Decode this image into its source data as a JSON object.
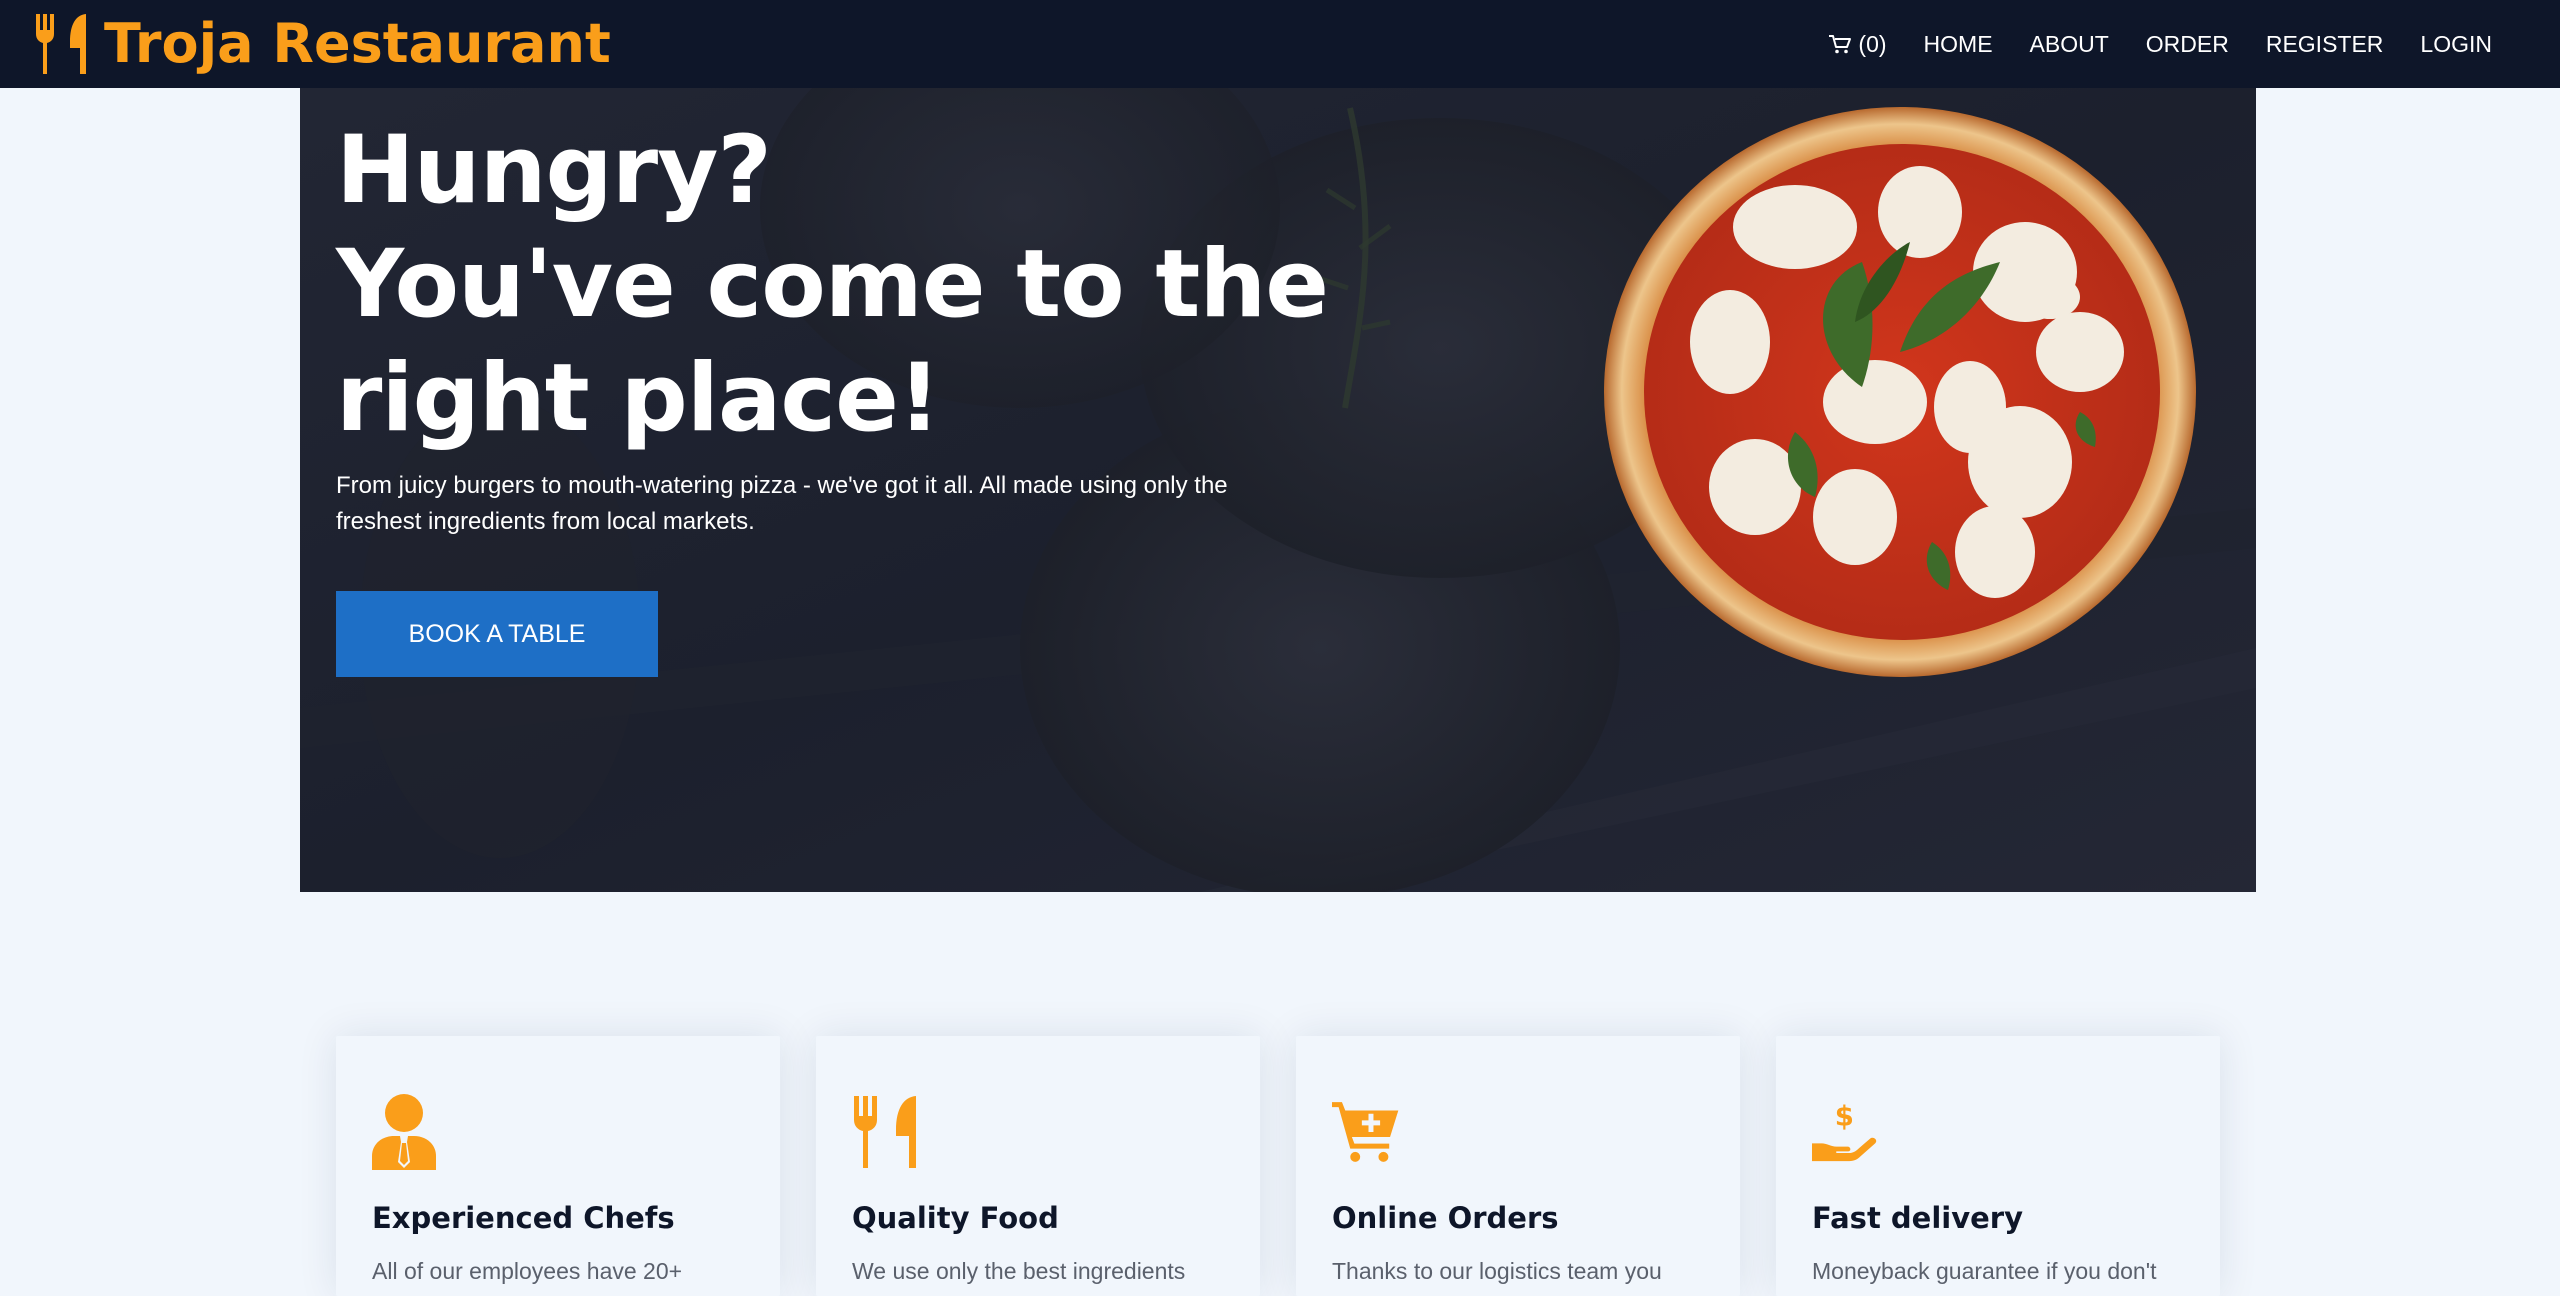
{
  "brand": {
    "name": "Troja Restaurant",
    "icon": "utensils-icon",
    "color": "#fa9e1a"
  },
  "nav": {
    "cart_count": "(0)",
    "cart_icon": "cart-icon",
    "items": [
      "HOME",
      "ABOUT",
      "ORDER",
      "REGISTER",
      "LOGIN"
    ]
  },
  "hero": {
    "title_lines": [
      "Hungry?",
      "You've come to the",
      "right place!"
    ],
    "subtitle_line1": "From juicy burgers to mouth-watering pizza - we've got it all. All made using only the",
    "subtitle_line2": "freshest ingredients from local markets.",
    "button_label": "BOOK A TABLE",
    "button_color": "#1e6fc6",
    "image": "pizza-image"
  },
  "features": [
    {
      "icon": "chef-icon",
      "title": "Experienced Chefs",
      "text": "All of our employees have 20+"
    },
    {
      "icon": "utensils-icon",
      "title": "Quality Food",
      "text": "We use only the best ingredients"
    },
    {
      "icon": "cart-plus-icon",
      "title": "Online Orders",
      "text": "Thanks to our logistics team you"
    },
    {
      "icon": "money-hand-icon",
      "title": "Fast delivery",
      "text": "Moneyback guarantee if you don't"
    }
  ],
  "colors": {
    "navbar": "#0e1629",
    "accent": "#fa9e1a",
    "page_background": "#f1f6fc"
  }
}
